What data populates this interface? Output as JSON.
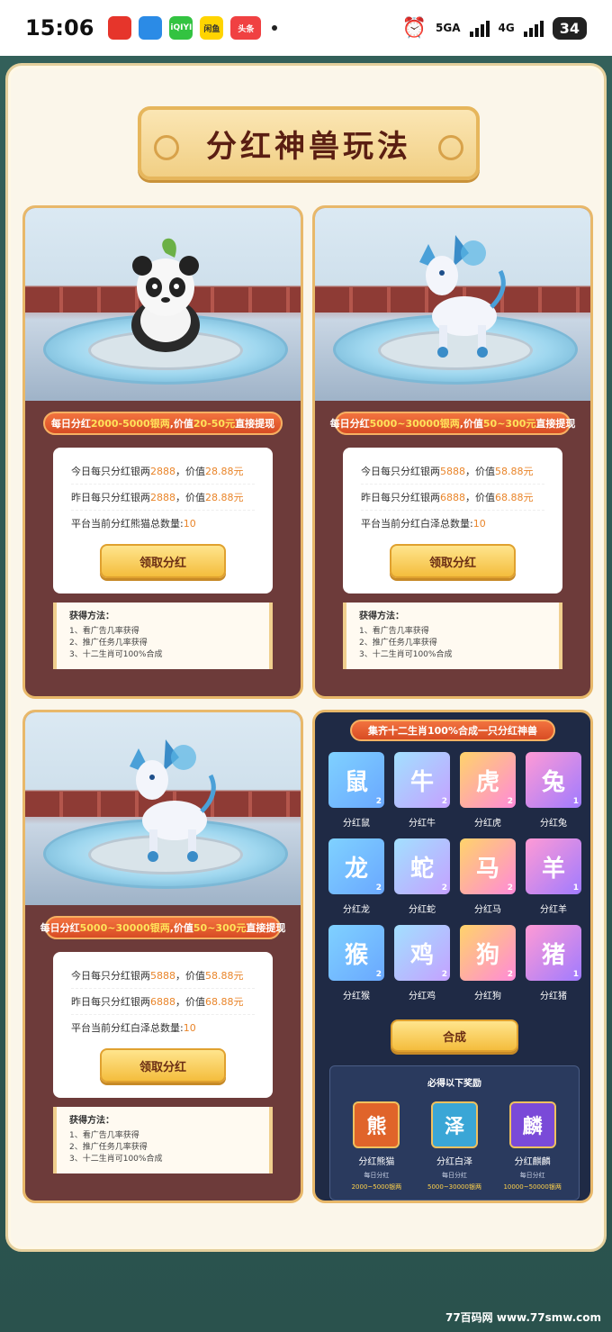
{
  "status_bar": {
    "time": "15:06",
    "apps": [
      {
        "icon": "weibo-icon",
        "color": "#e6352b",
        "label": ""
      },
      {
        "icon": "browser-icon",
        "color": "#2b8be6",
        "label": ""
      },
      {
        "icon": "iqiyi-icon",
        "color": "#33c341",
        "label": "iQIYI"
      },
      {
        "icon": "xianyu-icon",
        "color": "#ffd400",
        "label": "闲鱼"
      },
      {
        "icon": "toutiao-icon",
        "color": "#f04142",
        "label": "头条"
      }
    ],
    "network_1": "5GA",
    "network_2": "4G",
    "battery": "34"
  },
  "page": {
    "title": "分红神兽玩法"
  },
  "cards": [
    {
      "creature": "panda-icon",
      "headline_prefix": "每日分红",
      "headline_amount": "2000-5000银两",
      "headline_mid": ",价值",
      "headline_value": "20-50元",
      "headline_suffix": "直接提现",
      "today_label": "今日每只分红银两",
      "today_amount": "2888",
      "today_value_label": "，价值",
      "today_value": "28.88元",
      "yesterday_label": "昨日每只分红银两",
      "yesterday_amount": "2888",
      "yesterday_value_label": "，价值",
      "yesterday_value": "28.88元",
      "total_label": "平台当前分红熊猫总数量:",
      "total_count": "10",
      "claim_label": "领取分红",
      "method_title": "获得方法：",
      "methods": [
        "1、看广告几率获得",
        "2、推广任务几率获得",
        "3、十二生肖可100%合成"
      ]
    },
    {
      "creature": "baize-icon",
      "headline_prefix": "每日分红",
      "headline_amount": "5000~30000银两",
      "headline_mid": ",价值",
      "headline_value": "50~300元",
      "headline_suffix": "直接提现",
      "today_label": "今日每只分红银两",
      "today_amount": "5888",
      "today_value_label": "，价值",
      "today_value": "58.88元",
      "yesterday_label": "昨日每只分红银两",
      "yesterday_amount": "6888",
      "yesterday_value_label": "，价值",
      "yesterday_value": "68.88元",
      "total_label": "平台当前分红白泽总数量:",
      "total_count": "10",
      "claim_label": "领取分红",
      "method_title": "获得方法：",
      "methods": [
        "1、看广告几率获得",
        "2、推广任务几率获得",
        "3、十二生肖可100%合成"
      ]
    },
    {
      "creature": "baize-icon",
      "headline_prefix": "每日分红",
      "headline_amount": "5000~30000银两",
      "headline_mid": ",价值",
      "headline_value": "50~300元",
      "headline_suffix": "直接提现",
      "today_label": "今日每只分红银两",
      "today_amount": "5888",
      "today_value_label": "，价值",
      "today_value": "58.88元",
      "yesterday_label": "昨日每只分红银两",
      "yesterday_amount": "6888",
      "yesterday_value_label": "，价值",
      "yesterday_value": "68.88元",
      "total_label": "平台当前分红白泽总数量:",
      "total_count": "10",
      "claim_label": "领取分红",
      "method_title": "获得方法：",
      "methods": [
        "1、看广告几率获得",
        "2、推广任务几率获得",
        "3、十二生肖可100%合成"
      ]
    }
  ],
  "zodiac": {
    "headline": "集齐十二生肖100%合成一只分红神兽",
    "items": [
      {
        "name": "分红鼠",
        "count": "2",
        "glyph": "鼠",
        "icon": "rat-icon"
      },
      {
        "name": "分红牛",
        "count": "2",
        "glyph": "牛",
        "icon": "ox-icon"
      },
      {
        "name": "分红虎",
        "count": "2",
        "glyph": "虎",
        "icon": "tiger-icon"
      },
      {
        "name": "分红兔",
        "count": "1",
        "glyph": "兔",
        "icon": "rabbit-icon"
      },
      {
        "name": "分红龙",
        "count": "2",
        "glyph": "龙",
        "icon": "dragon-icon"
      },
      {
        "name": "分红蛇",
        "count": "2",
        "glyph": "蛇",
        "icon": "snake-icon"
      },
      {
        "name": "分红马",
        "count": "2",
        "glyph": "马",
        "icon": "horse-icon"
      },
      {
        "name": "分红羊",
        "count": "1",
        "glyph": "羊",
        "icon": "goat-icon"
      },
      {
        "name": "分红猴",
        "count": "2",
        "glyph": "猴",
        "icon": "monkey-icon"
      },
      {
        "name": "分红鸡",
        "count": "2",
        "glyph": "鸡",
        "icon": "rooster-icon"
      },
      {
        "name": "分红狗",
        "count": "2",
        "glyph": "狗",
        "icon": "dog-icon"
      },
      {
        "name": "分红猪",
        "count": "1",
        "glyph": "猪",
        "icon": "pig-icon"
      }
    ],
    "merge_label": "合成",
    "reward_title": "必得以下奖励",
    "rewards": [
      {
        "name": "分红熊猫",
        "sub": "每日分红",
        "value": "2000~5000银两",
        "glyph": "熊",
        "icon": "panda-icon",
        "color": "#e0642a"
      },
      {
        "name": "分红白泽",
        "sub": "每日分红",
        "value": "5000~30000银两",
        "glyph": "泽",
        "icon": "baize-icon",
        "color": "#3aa6d6"
      },
      {
        "name": "分红麒麟",
        "sub": "每日分红",
        "value": "10000~50000银两",
        "glyph": "麟",
        "icon": "qilin-icon",
        "color": "#7a4ad8"
      }
    ]
  },
  "watermark": "77百码网 www.77smw.com"
}
